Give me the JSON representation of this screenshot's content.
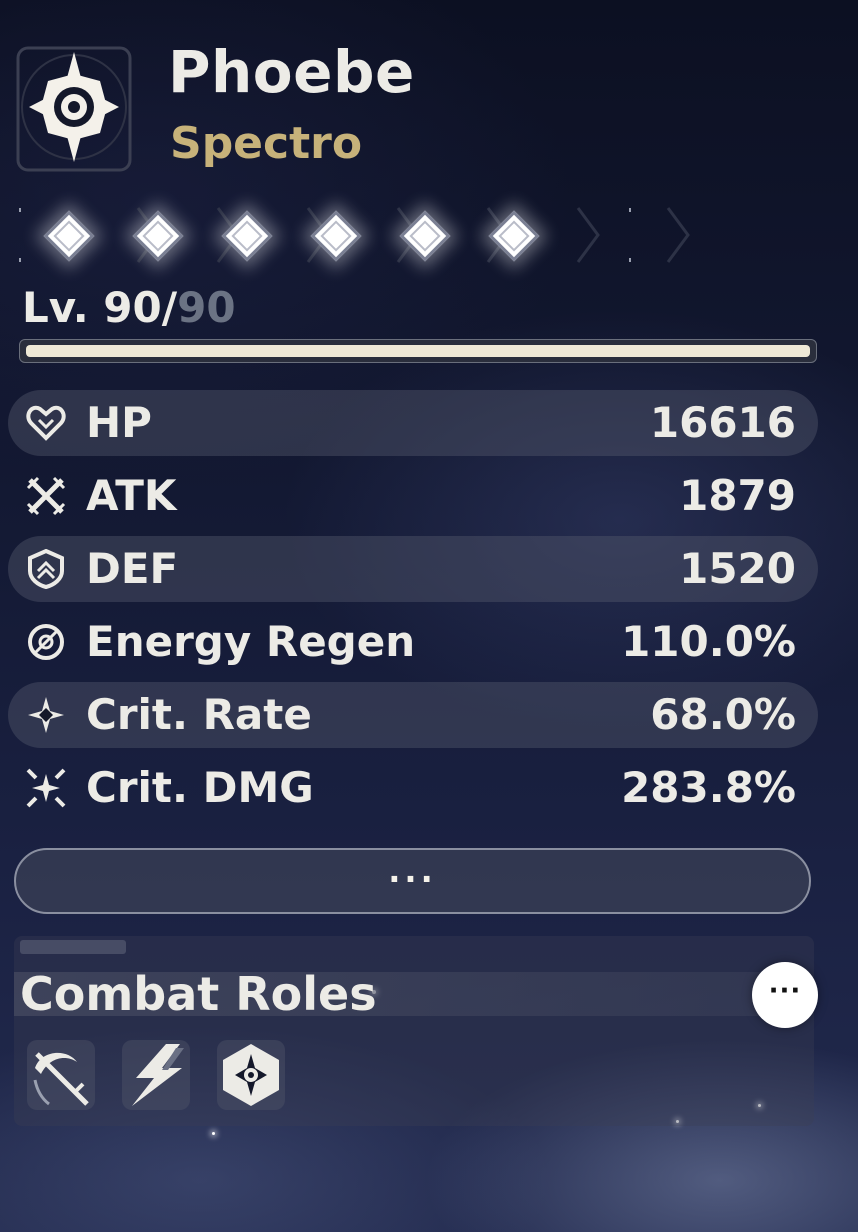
{
  "character": {
    "name": "Phoebe",
    "element": "Spectro",
    "element_icon": "spectro-star-icon",
    "element_color": "#c7b27a"
  },
  "sequence": {
    "nodes_unlocked": 6,
    "node_icon": "sequence-diamond-icon"
  },
  "level": {
    "prefix": "Lv. ",
    "current": "90",
    "separator": "/",
    "max": "90",
    "progress": 1.0
  },
  "stats": [
    {
      "icon": "heart-icon",
      "label": "HP",
      "value": "16616"
    },
    {
      "icon": "crossed-swords-icon",
      "label": "ATK",
      "value": "1879"
    },
    {
      "icon": "shield-icon",
      "label": "DEF",
      "value": "1520"
    },
    {
      "icon": "energy-regen-icon",
      "label": "Energy Regen",
      "value": "110.0%"
    },
    {
      "icon": "crit-rate-icon",
      "label": "Crit. Rate",
      "value": "68.0%"
    },
    {
      "icon": "crit-dmg-icon",
      "label": "Crit. DMG",
      "value": "283.8%"
    }
  ],
  "more_button": {
    "label": "···"
  },
  "combat_roles": {
    "title": "Combat Roles",
    "info_button_label": "···",
    "roles": [
      {
        "icon": "scythe-sword-icon"
      },
      {
        "icon": "lightning-slash-icon"
      },
      {
        "icon": "hexagon-sun-icon"
      }
    ]
  }
}
